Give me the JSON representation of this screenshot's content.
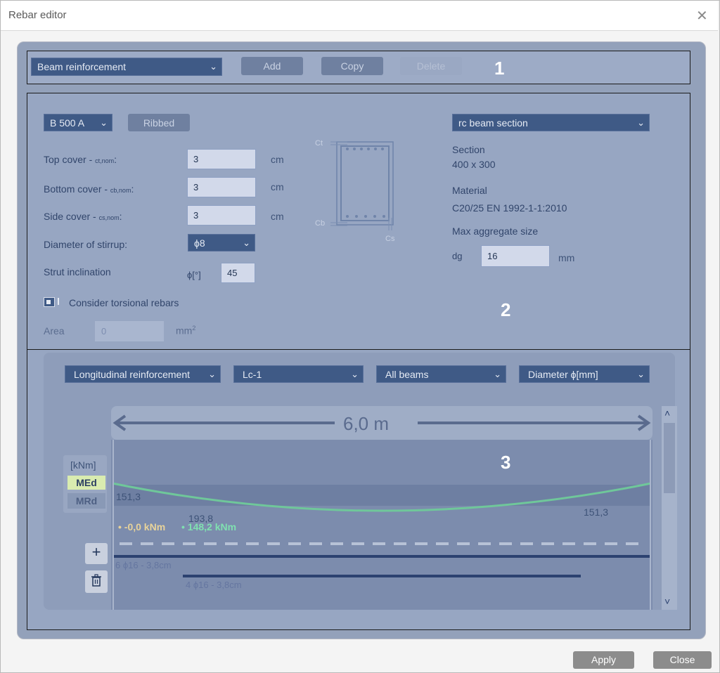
{
  "window": {
    "title": "Rebar editor",
    "close_glyph": "✕"
  },
  "section_numbers": {
    "one": "1",
    "two": "2",
    "three": "3"
  },
  "toolbar": {
    "selected": "Beam reinforcement",
    "add": "Add",
    "copy": "Copy",
    "delete": "Delete"
  },
  "props": {
    "material": "B 500 A",
    "ribbed": "Ribbed",
    "top_cover_label": "Top cover - ",
    "top_cover_sub": "ct,nom",
    "top_cover_value": "3",
    "bottom_cover_label": "Bottom cover - ",
    "bottom_cover_sub": "cb,nom",
    "bottom_cover_value": "3",
    "side_cover_label": "Side cover - ",
    "side_cover_sub": "cs,nom",
    "side_cover_value": "3",
    "unit_cm": "cm",
    "stirrup_label": "Diameter of stirrup:",
    "stirrup_value": "ϕ8",
    "strut_label": "Strut inclination",
    "strut_symbol": "ϕ[°]",
    "strut_value": "45",
    "torsion_label": "Consider torsional rebars",
    "area_label": "Area",
    "area_value": "0",
    "area_unit": "mm",
    "area_unit_sup": "2",
    "diagram_ct": "Ct",
    "diagram_cb": "Cb",
    "diagram_cs": "Cs"
  },
  "section_info": {
    "selected": "rc beam section",
    "section_label": "Section",
    "section_value": "400 x 300",
    "material_label": "Material",
    "material_value": "C20/25 EN 1992-1-1:2010",
    "aggregate_label": "Max aggregate size",
    "dg_label": "dg",
    "dg_value": "16",
    "dg_unit": "mm"
  },
  "filters": {
    "reinforcement": "Longitudinal reinforcement",
    "load_case": "Lc-1",
    "beams": "All beams",
    "display": "Diameter ϕ[mm]"
  },
  "beam_view": {
    "length": "6,0 m",
    "unit": "[kNm]",
    "legend_med": "MEd",
    "legend_mrd": "MRd",
    "left_value": "151,3",
    "mid_value": "193,8",
    "right_value": "151,3",
    "med_readout": "-0,0 kNm",
    "mrd_readout": "148,2 kNm",
    "rebar_top": "6  ϕ16 - 3,8cm",
    "rebar_bottom": "4  ϕ16 - 3,8cm",
    "add_glyph": "+",
    "scroll_up": "˄",
    "scroll_down": "˅"
  },
  "footer": {
    "apply": "Apply",
    "close": "Close"
  },
  "colors": {
    "med_line": "#6fc79a",
    "med_text": "#e8d39a",
    "mrd_text": "#7fe0b0",
    "rebar": "#2c4270"
  }
}
